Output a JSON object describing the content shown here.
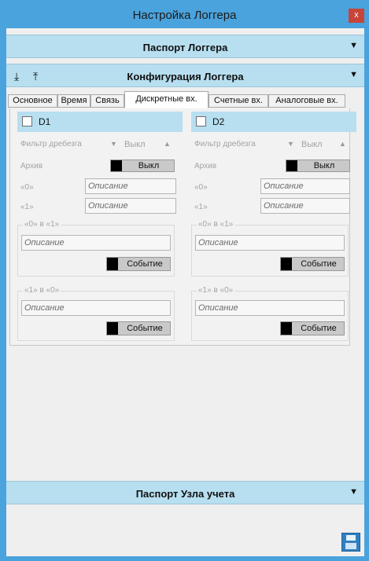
{
  "window": {
    "title": "Настройка Логгера",
    "close_glyph": "x"
  },
  "sections": {
    "passport": {
      "title": "Паспорт Логгера",
      "arrow": "▼"
    },
    "config": {
      "title": "Конфигурация Логгера",
      "arrow": "▼",
      "icons": [
        "download-icon",
        "upload-icon"
      ],
      "download_glyph": "⤓",
      "upload_glyph": "⤒"
    },
    "node_passport": {
      "title": "Паспорт Узла учета",
      "arrow": "▼"
    }
  },
  "tabs": [
    "Основное",
    "Время",
    "Связь",
    "Дискретные вх.",
    "Счетные вх.",
    "Аналоговые вх."
  ],
  "active_tab": "Дискретные вх.",
  "channels": [
    {
      "name": "D1",
      "checked": false,
      "filter_label": "Фильтр дребезга",
      "filter_value": "Выкл",
      "archive_label": "Архив",
      "archive_value": "Выкл",
      "state0_label": "«0»",
      "state0_placeholder": "Описание",
      "state1_label": "«1»",
      "state1_placeholder": "Описание",
      "transition_01": {
        "title": "«0» в «1»",
        "placeholder": "Описание",
        "event_label": "Событие"
      },
      "transition_10": {
        "title": "«1» в «0»",
        "placeholder": "Описание",
        "event_label": "Событие"
      }
    },
    {
      "name": "D2",
      "checked": false,
      "filter_label": "Фильтр дребезга",
      "filter_value": "Выкл",
      "archive_label": "Архив",
      "archive_value": "Выкл",
      "state0_label": "«0»",
      "state0_placeholder": "Описание",
      "state1_label": "«1»",
      "state1_placeholder": "Описание",
      "transition_01": {
        "title": "«0» в «1»",
        "placeholder": "Описание",
        "event_label": "Событие"
      },
      "transition_10": {
        "title": "«1» в «0»",
        "placeholder": "Описание",
        "event_label": "Событие"
      }
    }
  ],
  "colors": {
    "titlebar": "#4aa3dc",
    "section_header": "#b7dff0",
    "close": "#c7443a",
    "save": "#2f7fc1"
  },
  "footer": {
    "save_icon": "save-icon"
  }
}
